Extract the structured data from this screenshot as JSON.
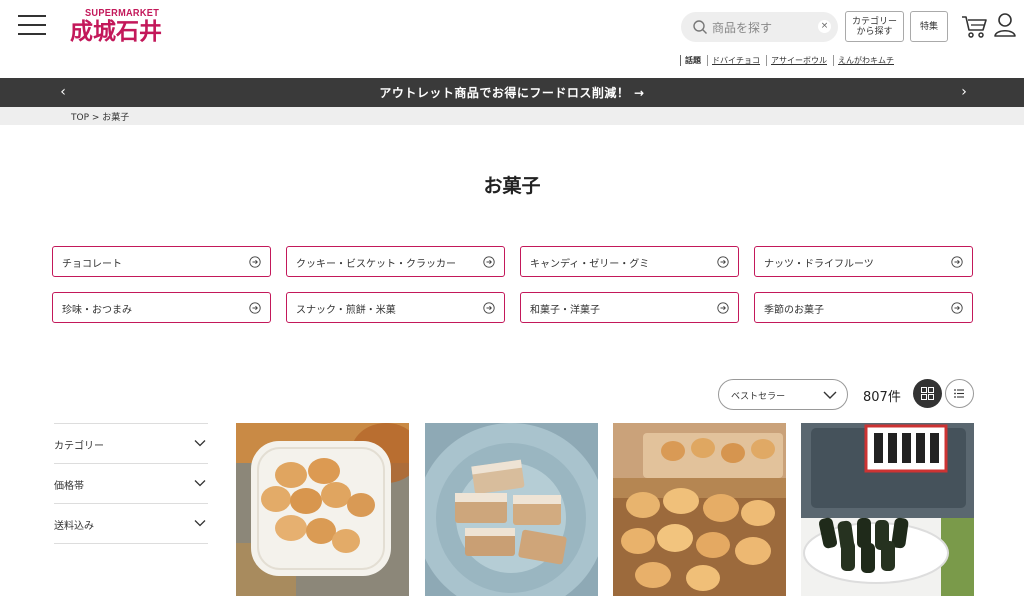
{
  "header": {
    "logo_top": "SUPERMARKET",
    "logo_main": "成城石井",
    "search_placeholder": "商品を探す",
    "search_clear": "×",
    "category_button": "カテゴリー\nから探す",
    "feature_button": "特集",
    "trending_label": "話題",
    "trending_links": [
      "ドバイチョコ",
      "アサイーボウル",
      "えんがわキムチ"
    ]
  },
  "banner": {
    "text": "アウトレット商品でお得にフードロス削減！ →",
    "prev": "‹",
    "next": "›"
  },
  "breadcrumb": {
    "home": "TOP",
    "separator": " > ",
    "current": "お菓子"
  },
  "page": {
    "title": "お菓子"
  },
  "subcategories": [
    "チョコレート",
    "クッキー・ビスケット・クラッカー",
    "キャンディ・ゼリー・グミ",
    "ナッツ・ドライフルーツ",
    "珍味・おつまみ",
    "スナック・煎餅・米菓",
    "和菓子・洋菓子",
    "季節のお菓子"
  ],
  "sort": {
    "selected": "ベストセラー",
    "count": "807件"
  },
  "filters": [
    "カテゴリー",
    "価格帯",
    "送料込み"
  ],
  "colors": {
    "brand": "#c3185a",
    "banner_bg": "#3a3a3a",
    "crumb_bg": "#eeeeee"
  },
  "icons": {
    "menu": "hamburger-icon",
    "search": "search-icon",
    "cart": "cart-icon",
    "user": "user-icon",
    "subcat_arrow": "arrow-circle-right-icon",
    "grid_view": "grid-view-icon",
    "list_view": "list-view-icon"
  }
}
